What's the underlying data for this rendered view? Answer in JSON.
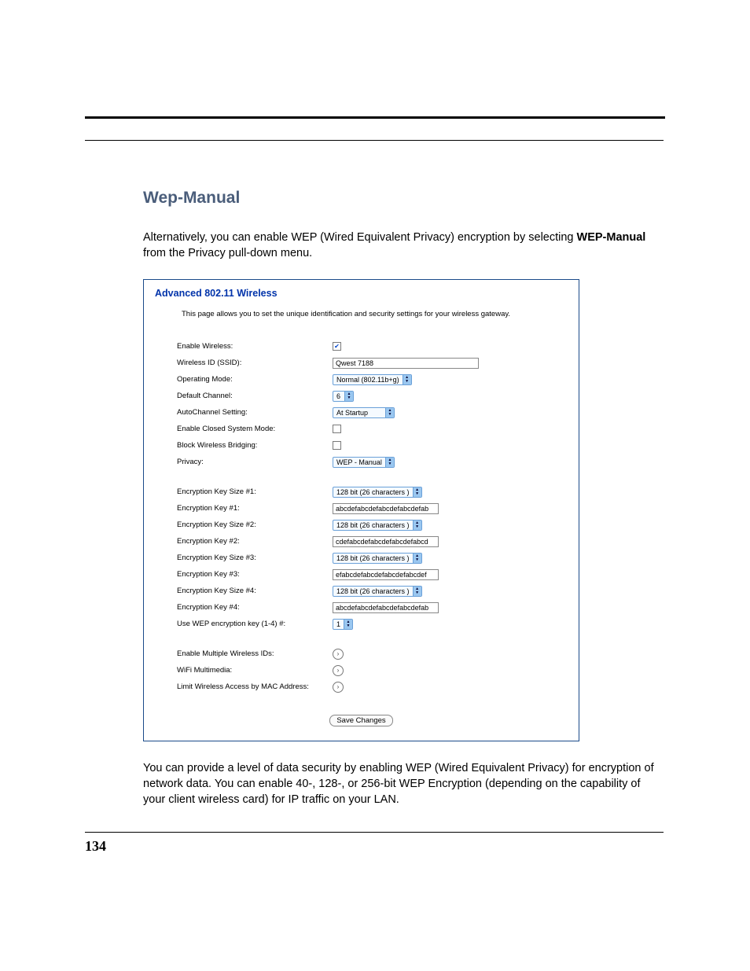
{
  "heading": "Wep-Manual",
  "intro": {
    "line1": "Alternatively, you can enable WEP (Wired Equivalent Privacy) encryption by selecting ",
    "bold": "WEP-Manual",
    "line2": " from the Privacy pull-down menu."
  },
  "panel": {
    "title": "Advanced 802.11 Wireless",
    "description": "This page allows you to set the unique identification and security settings for your wireless gateway.",
    "labels": {
      "enable_wireless": "Enable Wireless:",
      "ssid": "Wireless ID (SSID):",
      "operating_mode": "Operating Mode:",
      "default_channel": "Default Channel:",
      "autochannel": "AutoChannel Setting:",
      "closed_system": "Enable Closed System Mode:",
      "block_bridging": "Block Wireless Bridging:",
      "privacy": "Privacy:",
      "key_size_1": "Encryption Key Size #1:",
      "key_1": "Encryption Key #1:",
      "key_size_2": "Encryption Key Size #2:",
      "key_2": "Encryption Key #2:",
      "key_size_3": "Encryption Key Size #3:",
      "key_3": "Encryption Key #3:",
      "key_size_4": "Encryption Key Size #4:",
      "key_4": "Encryption Key #4:",
      "use_key": "Use WEP encryption key (1-4) #:",
      "multi_ids": "Enable Multiple Wireless IDs:",
      "wifi_mm": "WiFi Multimedia:",
      "mac_limit": "Limit Wireless Access by MAC Address:"
    },
    "values": {
      "enable_wireless_checked": "✔",
      "ssid": "Qwest 7188",
      "operating_mode": "Normal (802.11b+g)",
      "default_channel": "6",
      "autochannel": "At Startup",
      "closed_system_checked": "",
      "block_bridging_checked": "",
      "privacy": "WEP - Manual",
      "key_size_1": "128 bit (26 characters )",
      "key_1": "abcdefabcdefabcdefabcdefab",
      "key_size_2": "128 bit (26 characters )",
      "key_2": "cdefabcdefabcdefabcdefabcd",
      "key_size_3": "128 bit (26 characters )",
      "key_3": "efabcdefabcdefabcdefabcdef",
      "key_size_4": "128 bit (26 characters )",
      "key_4": "abcdefabcdefabcdefabcdefab",
      "use_key": "1"
    },
    "save_label": "Save Changes"
  },
  "outro": "You can provide a level of data security by enabling WEP (Wired Equivalent Privacy) for encryption of network data. You can enable 40-, 128-, or 256-bit WEP Encryption (depending on the capability of your client wireless card) for IP traffic on your LAN.",
  "page_number": "134"
}
